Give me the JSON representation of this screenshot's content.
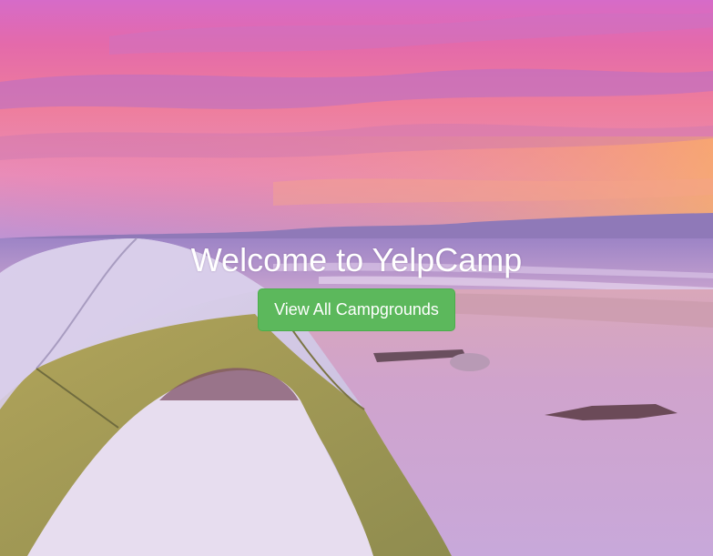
{
  "landing": {
    "title": "Welcome to YelpCamp",
    "view_button_label": "View All Campgrounds"
  },
  "colors": {
    "button_bg": "#5cb85c",
    "title_text": "#ffffff"
  }
}
